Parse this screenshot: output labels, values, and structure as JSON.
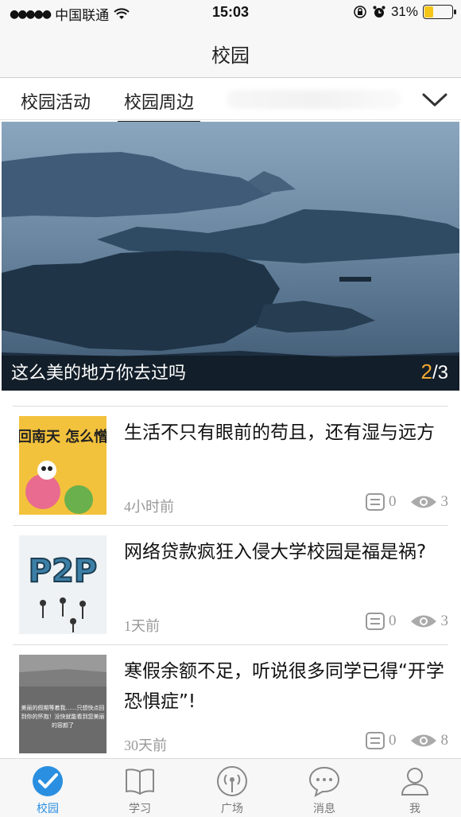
{
  "status": {
    "carrier": "中国联通",
    "time": "15:03",
    "battery": "31%",
    "battery_level": 0.31
  },
  "nav": {
    "title": "校园"
  },
  "tabs": [
    {
      "label": "校园活动",
      "active": false
    },
    {
      "label": "校园周边",
      "active": true
    }
  ],
  "banner": {
    "caption": "这么美的地方你去过吗",
    "current": "2",
    "total": "/3"
  },
  "news": [
    {
      "title": "生活不只有眼前的苟且，还有湿与远方",
      "time": "4小时前",
      "comments": "0",
      "views": "3",
      "thumb_text": "回南天 怎么憎"
    },
    {
      "title": "网络贷款疯狂入侵大学校园是福是祸?",
      "time": "1天前",
      "comments": "0",
      "views": "3",
      "thumb_text": "P2P"
    },
    {
      "title": "寒假余额不足，听说很多同学已得“开学恐惧症”!",
      "time": "30天前",
      "comments": "0",
      "views": "8",
      "thumb_text": "美丽的假期等着我……只想快点回到你的怀抱！没快就能看到您美丽的容颜了"
    }
  ],
  "tabbar": [
    {
      "label": "校园",
      "icon": "check-circle-icon",
      "active": true
    },
    {
      "label": "学习",
      "icon": "book-icon",
      "active": false
    },
    {
      "label": "广场",
      "icon": "broadcast-icon",
      "active": false
    },
    {
      "label": "消息",
      "icon": "chat-bubble-icon",
      "active": false
    },
    {
      "label": "我",
      "icon": "person-icon",
      "active": false
    }
  ],
  "colors": {
    "accent": "#2a8fe0",
    "pager_active": "#f0a830",
    "battery": "#f5c518"
  }
}
